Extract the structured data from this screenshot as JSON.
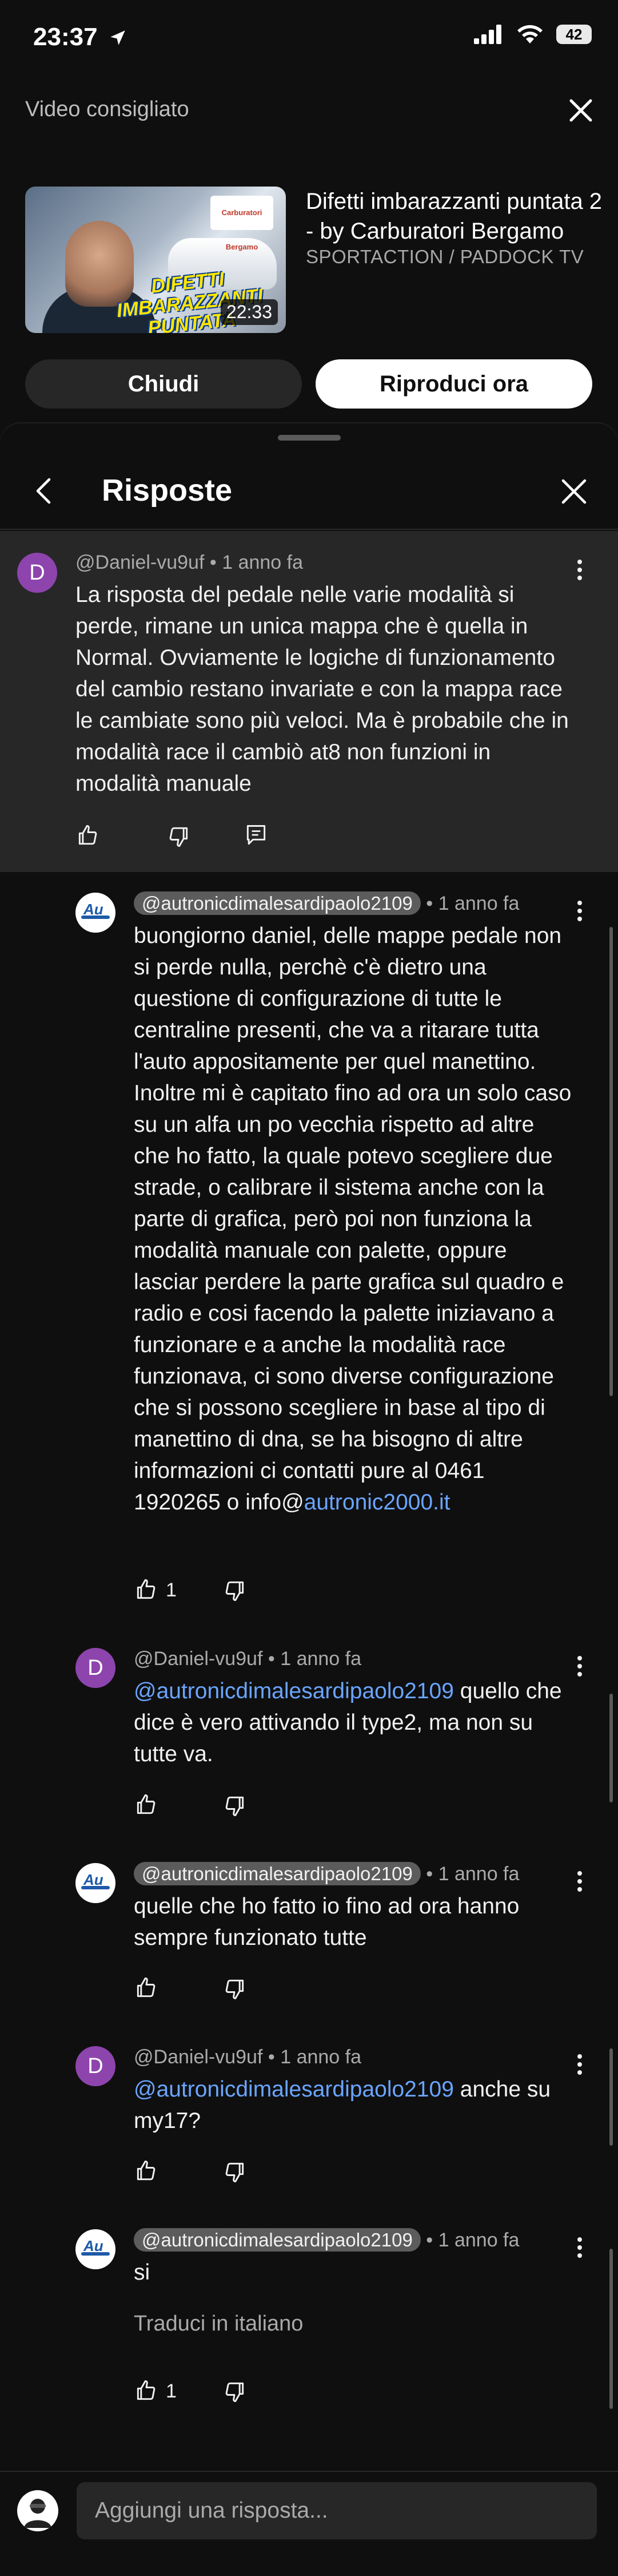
{
  "status_bar": {
    "time": "23:37",
    "battery": "42"
  },
  "recommended": {
    "heading": "Video consigliato",
    "video": {
      "title": "Difetti imbarazzanti puntata 2 -  by Carburatori Bergamo",
      "channel": "SPORTACTION / PADDOCK TV",
      "duration": "22:33",
      "thumb_caption": "DIFETTI IMBARAZZANTI PUNTATA",
      "thumb_logo": "Carburatori Bergamo"
    },
    "close_label": "Chiudi",
    "play_label": "Riproduci ora"
  },
  "sheet": {
    "title": "Risposte"
  },
  "parent_comment": {
    "author": "@Daniel-vu9uf",
    "time": "1 anno fa",
    "avatar_letter": "D",
    "text": "La risposta del pedale nelle varie modalità si perde, rimane un unica mappa che è quella in Normal. Ovviamente le logiche di funzionamento del cambio restano invariate e con la mappa race le cambiate sono più veloci. Ma è probabile che in modalità race il cambiò at8 non funzioni in modalità manuale"
  },
  "replies": [
    {
      "author": "@autronicdimalesardipaolo2109",
      "time": "1 anno fa",
      "text": "buongiorno daniel, delle mappe pedale non si perde nulla, perchè c'è dietro una questione di configurazione di tutte le centraline presenti, che va a ritarare tutta l'auto appositamente per quel manettino. Inoltre mi è capitato fino ad ora un solo caso su un alfa un po vecchia rispetto ad altre che ho fatto, la quale potevo scegliere due strade, o calibrare il sistema anche con la parte di grafica,  però poi non funziona la modalità manuale con palette, oppure lasciar perdere la parte grafica sul quadro e radio e cosi facendo la palette iniziavano a funzionare e a anche la modalità race funzionava, ci sono diverse configurazione che si possono scegliere in base al tipo di manettino di dna, se ha bisogno di altre informazioni ci contatti pure al 0461 1920265 o info@",
      "link": "autronic2000.it",
      "likes": "1"
    },
    {
      "author": "@Daniel-vu9uf",
      "avatar_letter": "D",
      "time": "1 anno fa",
      "mention": "@autronicdimalesardipaolo2109",
      "text": "  quello che dice è vero attivando il type2, ma non su tutte va."
    },
    {
      "author": "@autronicdimalesardipaolo2109",
      "time": "1 anno fa",
      "text": "quelle che ho fatto io fino ad ora hanno sempre funzionato tutte"
    },
    {
      "author": "@Daniel-vu9uf",
      "avatar_letter": "D",
      "time": "1 anno fa",
      "mention": "@autronicdimalesardipaolo2109",
      "text": "  anche su my17?"
    },
    {
      "author": "@autronicdimalesardipaolo2109",
      "time": "1 anno fa",
      "text": "si",
      "translate": "Traduci in italiano",
      "likes": "1"
    }
  ],
  "separator": "•",
  "avatar_logo_text": "Au",
  "reply_input": {
    "placeholder": "Aggiungi una risposta..."
  },
  "colors": {
    "background": "#0f0f0f",
    "highlight": "#272727",
    "link": "#6aa5ff",
    "avatar_d": "#8e44ad"
  }
}
